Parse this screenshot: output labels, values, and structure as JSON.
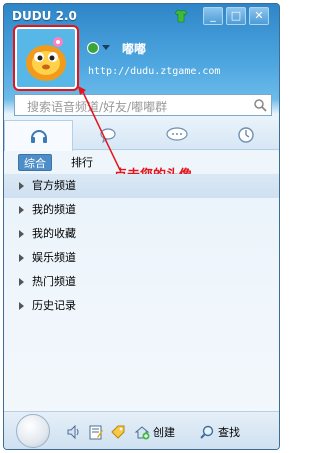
{
  "window": {
    "title": "DUDU 2.0",
    "buttons": {
      "minimize": "_",
      "maximize": "□",
      "close": "✕"
    }
  },
  "profile": {
    "nickname": "嘟嘟",
    "url": "http://dudu.ztgame.com"
  },
  "search": {
    "placeholder": "搜索语音频道/好友/嘟嘟群"
  },
  "tabs": [
    {
      "icon": "headphones-icon"
    },
    {
      "icon": "chat-bubble-icon"
    },
    {
      "icon": "group-chat-icon"
    },
    {
      "icon": "clock-icon"
    }
  ],
  "subtabs": {
    "active": "综合",
    "other": "排行"
  },
  "annotation": "点击您的头像",
  "list": [
    {
      "label": "官方频道"
    },
    {
      "label": "我的频道"
    },
    {
      "label": "我的收藏"
    },
    {
      "label": "娱乐频道"
    },
    {
      "label": "热门频道"
    },
    {
      "label": "历史记录"
    }
  ],
  "bottom": {
    "create": "创建",
    "find": "查找"
  },
  "colors": {
    "accent": "#2e86c8",
    "annotation": "#e4141b"
  }
}
